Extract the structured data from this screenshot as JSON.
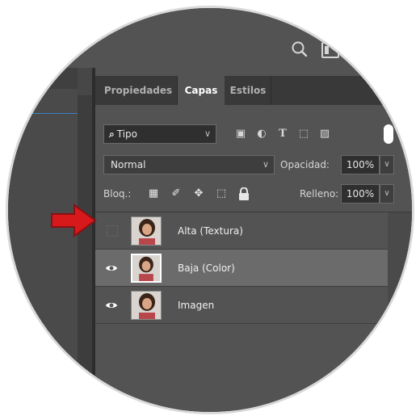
{
  "colors": {
    "panel_bg": "#535353",
    "selected_row": "#6b6b6b",
    "arrow": "#d7191c",
    "tab_bar": "#393939"
  },
  "tabs": [
    {
      "label": "Propiedades",
      "active": false
    },
    {
      "label": "Capas",
      "active": true
    },
    {
      "label": "Estilos",
      "active": false
    }
  ],
  "filter": {
    "kind_label": "Tipo"
  },
  "blend": {
    "mode": "Normal",
    "opacity_label": "Opacidad:",
    "opacity_value": "100%"
  },
  "lock": {
    "label": "Bloq.:",
    "fill_label": "Relleno:",
    "fill_value": "100%"
  },
  "layers": [
    {
      "name": "Alta (Textura)",
      "visible": false,
      "selected": false
    },
    {
      "name": "Baja (Color)",
      "visible": true,
      "selected": true
    },
    {
      "name": "Imagen",
      "visible": true,
      "selected": false
    }
  ]
}
